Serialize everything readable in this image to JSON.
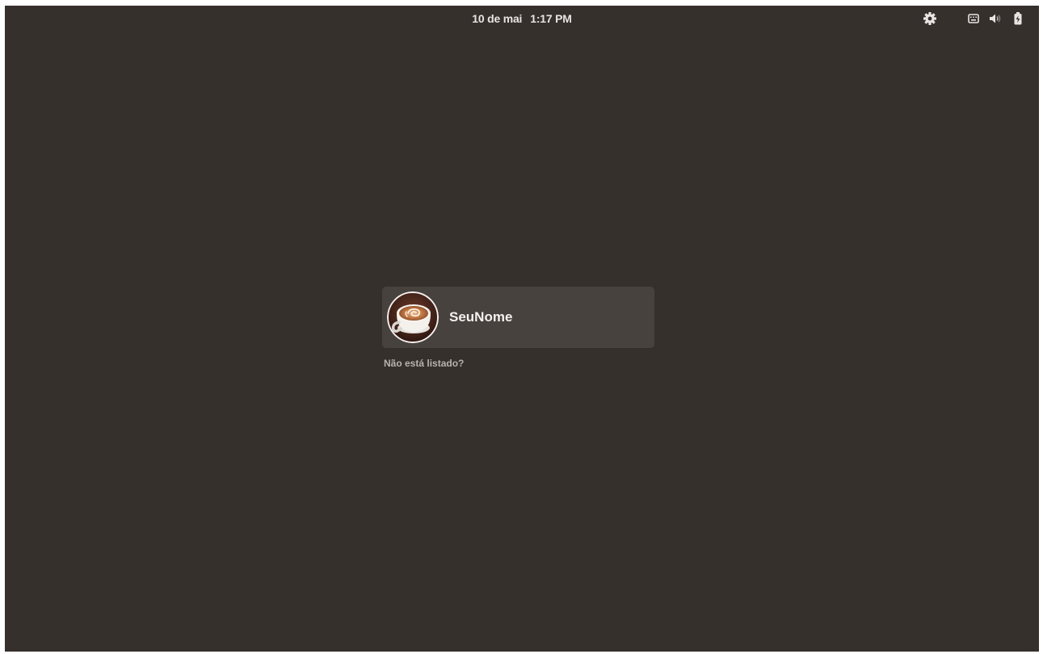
{
  "topbar": {
    "date": "10 de mai",
    "time": "1:17 PM",
    "icons": [
      "gear-icon",
      "keyboard-icon",
      "volume-icon",
      "battery-icon"
    ]
  },
  "login": {
    "users": [
      {
        "name": "SeuNome",
        "avatar": "coffee-latte-art-avatar"
      }
    ],
    "not_listed_label": "Não está listado?"
  },
  "colors": {
    "background": "#36302d",
    "card": "#48423f",
    "text": "#f3f0ee",
    "muted_text": "#b8b2ad"
  }
}
